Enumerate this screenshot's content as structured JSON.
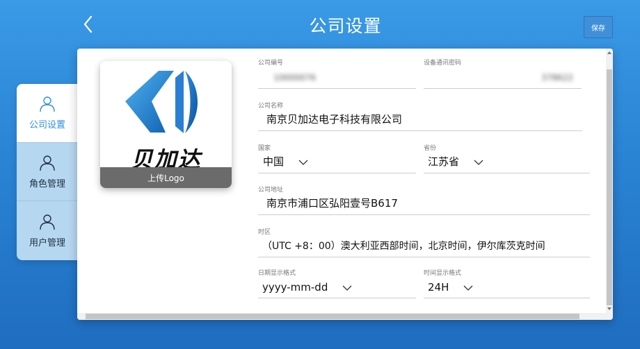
{
  "header": {
    "title": "公司设置",
    "save_label": "保存",
    "back_icon": "chevron-left-icon"
  },
  "sidebar": {
    "items": [
      {
        "label": "公司设置",
        "icon": "user-icon",
        "active": true
      },
      {
        "label": "角色管理",
        "icon": "user-icon",
        "active": false
      },
      {
        "label": "用户管理",
        "icon": "user-icon",
        "active": false
      }
    ]
  },
  "logo": {
    "brand_text": "贝加达",
    "upload_label": "上传Logo",
    "colors": {
      "primary": "#1a7fd6",
      "dark": "#0f5fb0"
    }
  },
  "form": {
    "company_id": {
      "label": "公司编号",
      "value": "10000076"
    },
    "device_password": {
      "label": "设备通讯密码",
      "value": "378622"
    },
    "company_name": {
      "label": "公司名称",
      "value": "南京贝加达电子科技有限公司"
    },
    "country": {
      "label": "国家",
      "value": "中国"
    },
    "province": {
      "label": "省份",
      "value": "江苏省"
    },
    "address": {
      "label": "公司地址",
      "value": "南京市浦口区弘阳壹号B617"
    },
    "timezone": {
      "label": "时区",
      "value": "（UTC +8：00）澳大利亚西部时间，北京时间，伊尔库茨克时间"
    },
    "date_format": {
      "label": "日期显示格式",
      "value": "yyyy-mm-dd"
    },
    "time_format": {
      "label": "时间显示格式",
      "value": "24H"
    }
  },
  "colors": {
    "accent": "#2f8fe0",
    "sidebar_bg": "#b6d7f0",
    "background": "#2a84d4"
  }
}
